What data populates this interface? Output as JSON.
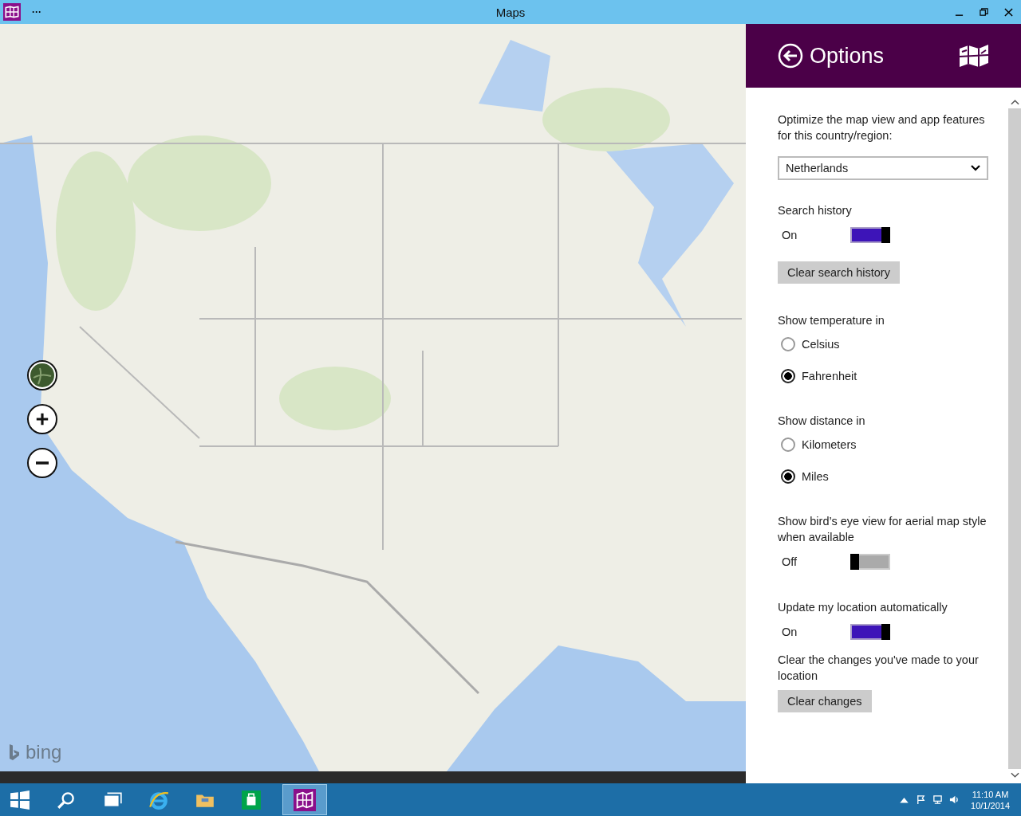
{
  "window": {
    "title": "Maps",
    "menu": "···"
  },
  "map": {
    "attribution": "bing"
  },
  "panel": {
    "title": "Options",
    "settings": [
      {
        "kind": "dropdown",
        "label": "Optimize the map view and app features for this country/region:",
        "value": "Netherlands"
      },
      {
        "kind": "toggle",
        "label": "Search history",
        "state_label": "On",
        "on": true
      },
      {
        "kind": "button",
        "label": "Clear search history"
      },
      {
        "kind": "radio",
        "label": "Show temperature in",
        "options": [
          {
            "label": "Celsius",
            "selected": false
          },
          {
            "label": "Fahrenheit",
            "selected": true
          }
        ]
      },
      {
        "kind": "radio",
        "label": "Show distance in",
        "options": [
          {
            "label": "Kilometers",
            "selected": false
          },
          {
            "label": "Miles",
            "selected": true
          }
        ]
      },
      {
        "kind": "toggle",
        "label": "Show bird’s eye view for aerial map style when available",
        "state_label": "Off",
        "on": false
      },
      {
        "kind": "toggle",
        "label": "Update my location automatically",
        "state_label": "On",
        "on": true
      },
      {
        "kind": "button",
        "description": "Clear the changes you've made to your location",
        "label": "Clear changes"
      }
    ]
  },
  "taskbar": {
    "time": "11:10 AM",
    "date": "10/1/2014"
  }
}
